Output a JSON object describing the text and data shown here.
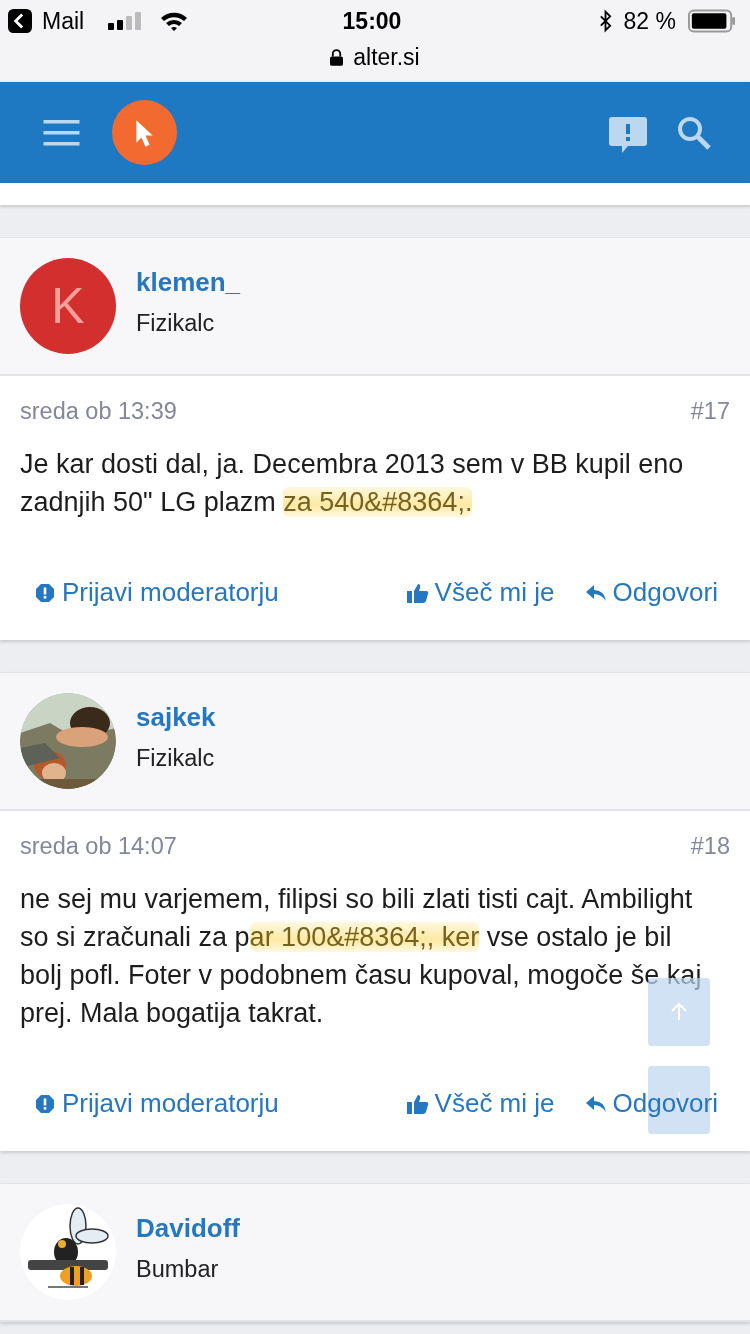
{
  "status_bar": {
    "back_label": "Mail",
    "time": "15:00",
    "battery": "82 %",
    "url": "alter.si"
  },
  "posts": [
    {
      "author": "klemen_",
      "rank": "Fizikalc",
      "avatar": {
        "kind": "letter",
        "letter": "K",
        "color": "#d32f2f"
      },
      "date": "sreda ob 13:39",
      "number": "#17",
      "body": [
        {
          "text": "Je kar dosti dal, ja. Decembra 2013 sem v BB kupil eno zadnjih 50\" LG plazm ",
          "highlighted": false
        },
        {
          "text": "za 540&#8364;.",
          "highlighted": true
        }
      ],
      "actions": {
        "report": "Prijavi moderatorju",
        "like": "Všeč mi je",
        "reply": "Odgovori"
      }
    },
    {
      "author": "sajkek",
      "rank": "Fizikalc",
      "date": "sreda ob 14:07",
      "number": "#18",
      "body": [
        {
          "text": "ne sej mu varjemem, filipsi so bili zlati tisti cajt. Ambilight so si zračunali za p",
          "highlighted": false
        },
        {
          "text": "ar 100&#8364;, ker",
          "highlighted": true
        },
        {
          "text": " vse ostalo je bil bolj pofl. Foter v podobnem času kupoval, mogoče še kaj prej. Mala bogatija takrat.",
          "highlighted": false
        }
      ],
      "actions": {
        "report": "Prijavi moderatorju",
        "like": "Všeč mi je",
        "reply": "Odgovori"
      }
    },
    {
      "author": "Davidoff",
      "rank": "Bumbar",
      "avatar": {
        "kind": "logo"
      }
    }
  ]
}
